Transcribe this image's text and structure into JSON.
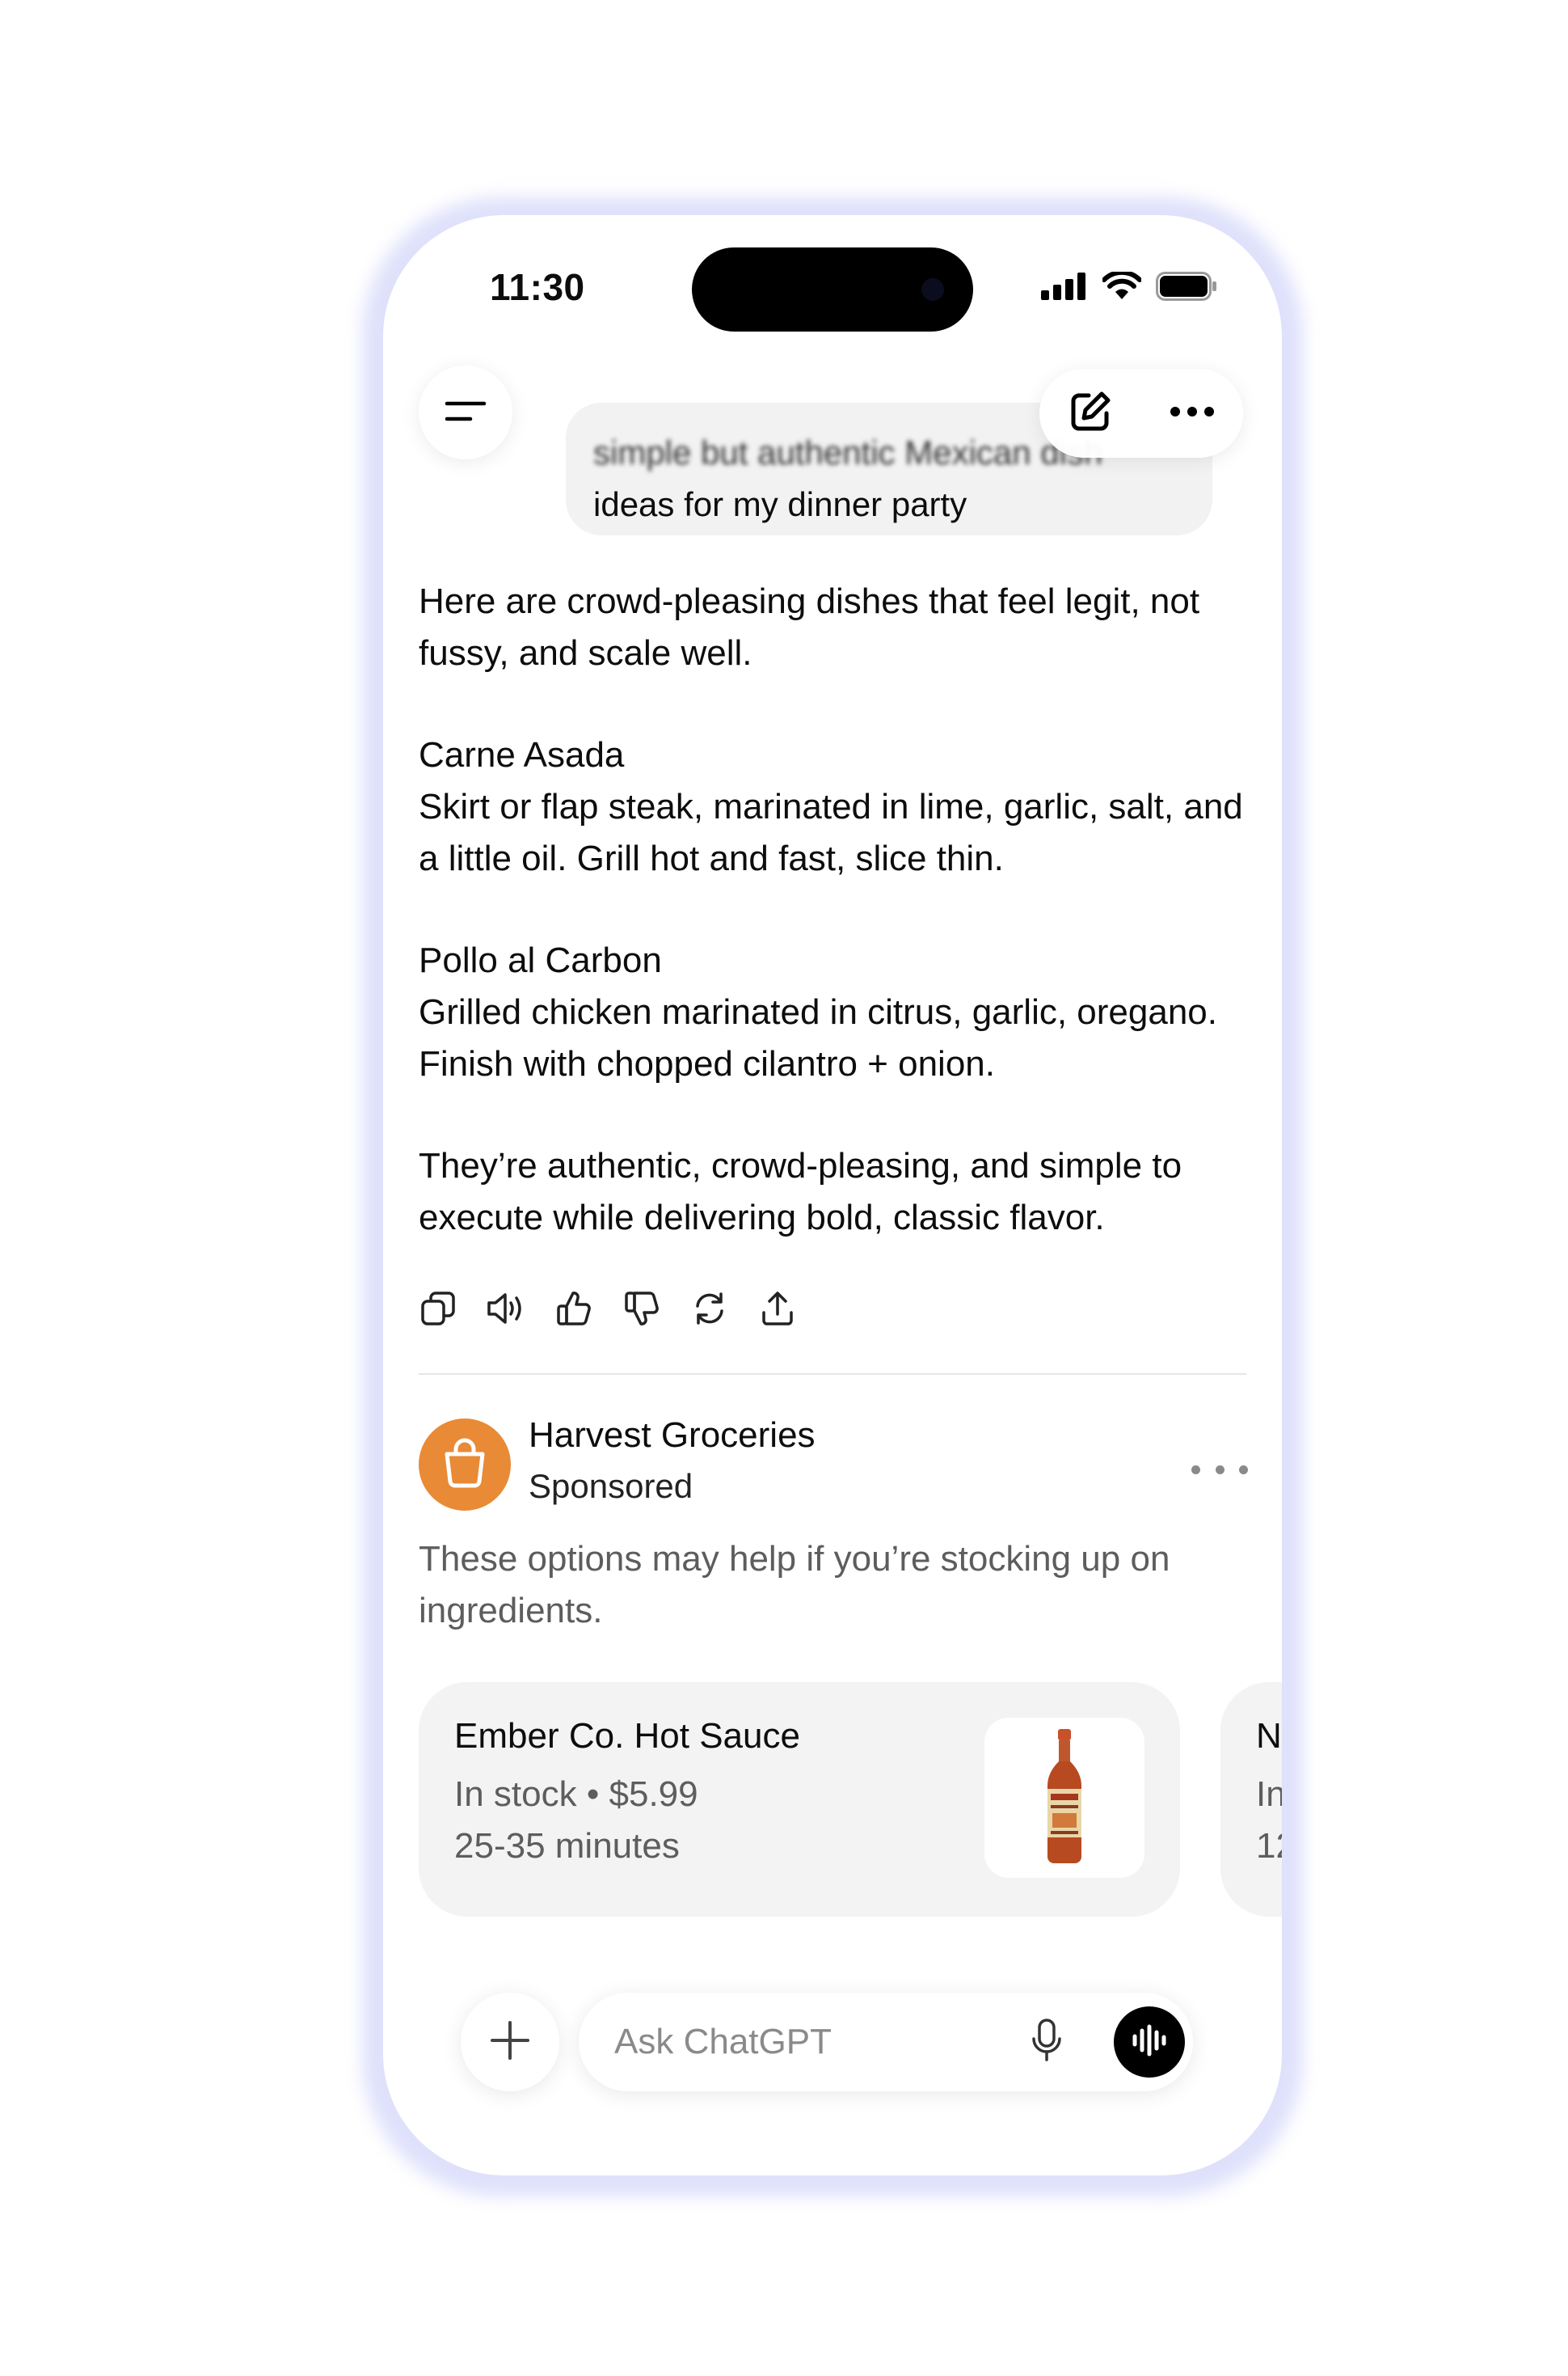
{
  "status_bar": {
    "time": "11:30",
    "icons": [
      "cellular-signal-icon",
      "wifi-icon",
      "battery-icon"
    ]
  },
  "header": {
    "menu_icon": "menu-icon",
    "new_chat_icon": "compose-icon",
    "more_icon": "more-horizontal-icon"
  },
  "user_message": {
    "line1": "simple but authentic Mexican dish",
    "line2": "ideas for my dinner party"
  },
  "assistant_message": {
    "intro": "Here are crowd-pleasing dishes that feel legit, not fussy, and scale well.",
    "dishes": [
      {
        "name": "Carne Asada",
        "description": "Skirt or flap steak, marinated in lime, garlic, salt, and a little oil. Grill hot and fast, slice thin."
      },
      {
        "name": "Pollo al Carbon",
        "description": "Grilled chicken marinated in citrus, garlic, oregano. Finish with chopped cilantro + onion."
      }
    ],
    "closing": "They’re authentic, crowd-pleasing, and simple to execute while delivering bold, classic flavor.",
    "actions": [
      "copy-icon",
      "read-aloud-icon",
      "thumbs-up-icon",
      "thumbs-down-icon",
      "regenerate-icon",
      "share-icon"
    ]
  },
  "sponsored": {
    "advertiser": "Harvest Groceries",
    "label": "Sponsored",
    "logo_icon": "shopping-bag-icon",
    "logo_color": "#e98a36",
    "description": "These options may help if you’re stocking up on ingredients.",
    "products": [
      {
        "title": "Ember Co. Hot Sauce",
        "availability": "In stock",
        "separator": "•",
        "price": "$5.99",
        "delivery": "25-35 minutes",
        "image_icon": "hot-sauce-bottle-icon"
      },
      {
        "title": "N",
        "availability": "In",
        "delivery": "12"
      }
    ]
  },
  "composer": {
    "placeholder": "Ask ChatGPT",
    "plus_icon": "plus-icon",
    "mic_icon": "microphone-icon",
    "voice_icon": "voice-mode-icon"
  }
}
